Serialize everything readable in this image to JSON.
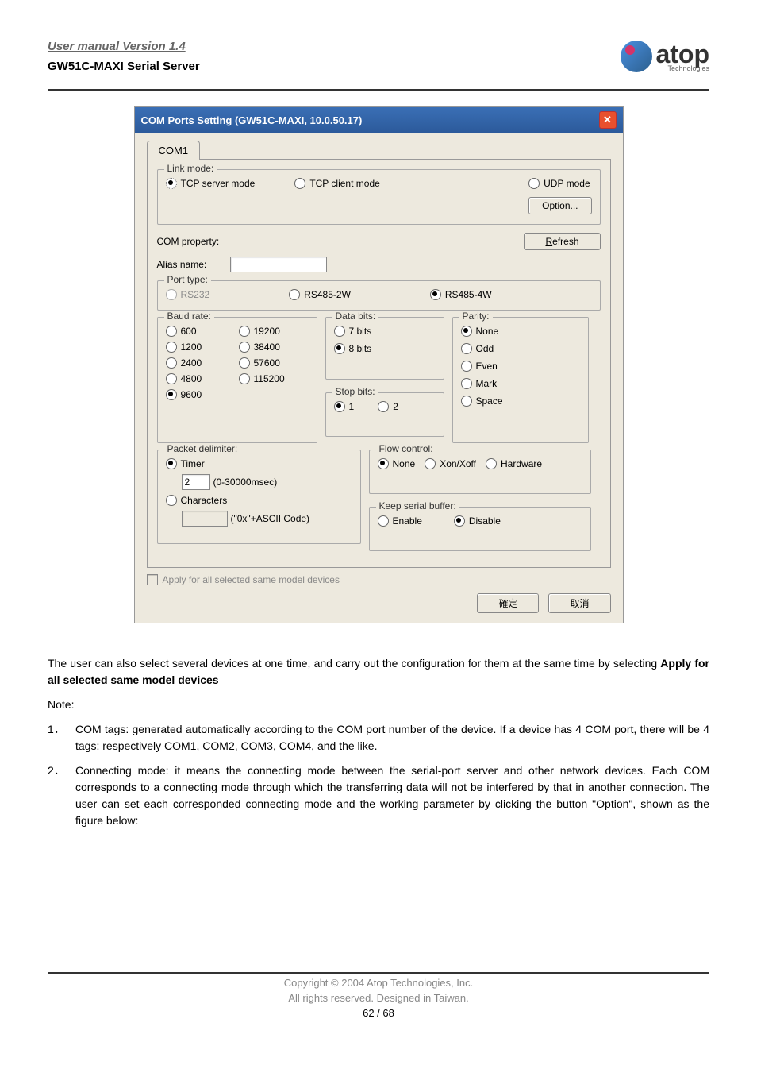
{
  "header": {
    "manual_title": "User manual Version 1.4",
    "product_name": "GW51C-MAXI Serial Server",
    "logo_text": "atop",
    "logo_sub": "Technologies"
  },
  "dialog": {
    "title": "COM Ports Setting (GW51C-MAXI, 10.0.50.17)",
    "tab": "COM1",
    "link_mode": {
      "legend": "Link mode:",
      "tcp_server": "TCP server mode",
      "tcp_client": "TCP client mode",
      "udp": "UDP mode",
      "option_btn": "Option..."
    },
    "com_property_label": "COM property:",
    "refresh_btn": "Refresh",
    "alias_label": "Alias name:",
    "port_type": {
      "legend": "Port type:",
      "rs232": "RS232",
      "rs485_2w": "RS485-2W",
      "rs485_4w": "RS485-4W"
    },
    "baud_rate": {
      "legend": "Baud rate:",
      "r600": "600",
      "r1200": "1200",
      "r2400": "2400",
      "r4800": "4800",
      "r9600": "9600",
      "r19200": "19200",
      "r38400": "38400",
      "r57600": "57600",
      "r115200": "115200"
    },
    "data_bits": {
      "legend": "Data bits:",
      "b7": "7 bits",
      "b8": "8 bits"
    },
    "stop_bits": {
      "legend": "Stop bits:",
      "s1": "1",
      "s2": "2"
    },
    "parity": {
      "legend": "Parity:",
      "none": "None",
      "odd": "Odd",
      "even": "Even",
      "mark": "Mark",
      "space": "Space"
    },
    "packet_delimiter": {
      "legend": "Packet delimiter:",
      "timer": "Timer",
      "timer_value": "2",
      "timer_range": "(0-30000msec)",
      "characters": "Characters",
      "chars_hint": "(\"0x\"+ASCII Code)"
    },
    "flow_control": {
      "legend": "Flow control:",
      "none": "None",
      "xonxoff": "Xon/Xoff",
      "hardware": "Hardware"
    },
    "keep_serial": {
      "legend": "Keep serial buffer:",
      "enable": "Enable",
      "disable": "Disable"
    },
    "apply_all": "Apply for all selected same model devices",
    "ok_btn": "確定",
    "cancel_btn": "取消"
  },
  "body": {
    "para1a": "The user can also select several devices at one time, and carry out the configuration for them at the same time by selecting ",
    "para1b": "Apply for all selected same model devices",
    "note_label": "Note:",
    "item1_num": "1．",
    "item1": "COM tags: generated automatically according to the COM port number of the device. If a device has 4 COM port, there will be 4 tags: respectively COM1, COM2, COM3, COM4, and the like.",
    "item2_num": "2．",
    "item2": "Connecting mode: it means the connecting mode between the serial-port server and other network devices. Each COM corresponds to a connecting mode through which the transferring data will not be interfered by that in another connection. The user can set each corresponded connecting mode and the working parameter by clicking the button \"Option\", shown as the figure below:"
  },
  "footer": {
    "copyright": "Copyright © 2004 Atop Technologies, Inc.",
    "rights": "All rights reserved. Designed in Taiwan.",
    "page": "62 / 68"
  }
}
